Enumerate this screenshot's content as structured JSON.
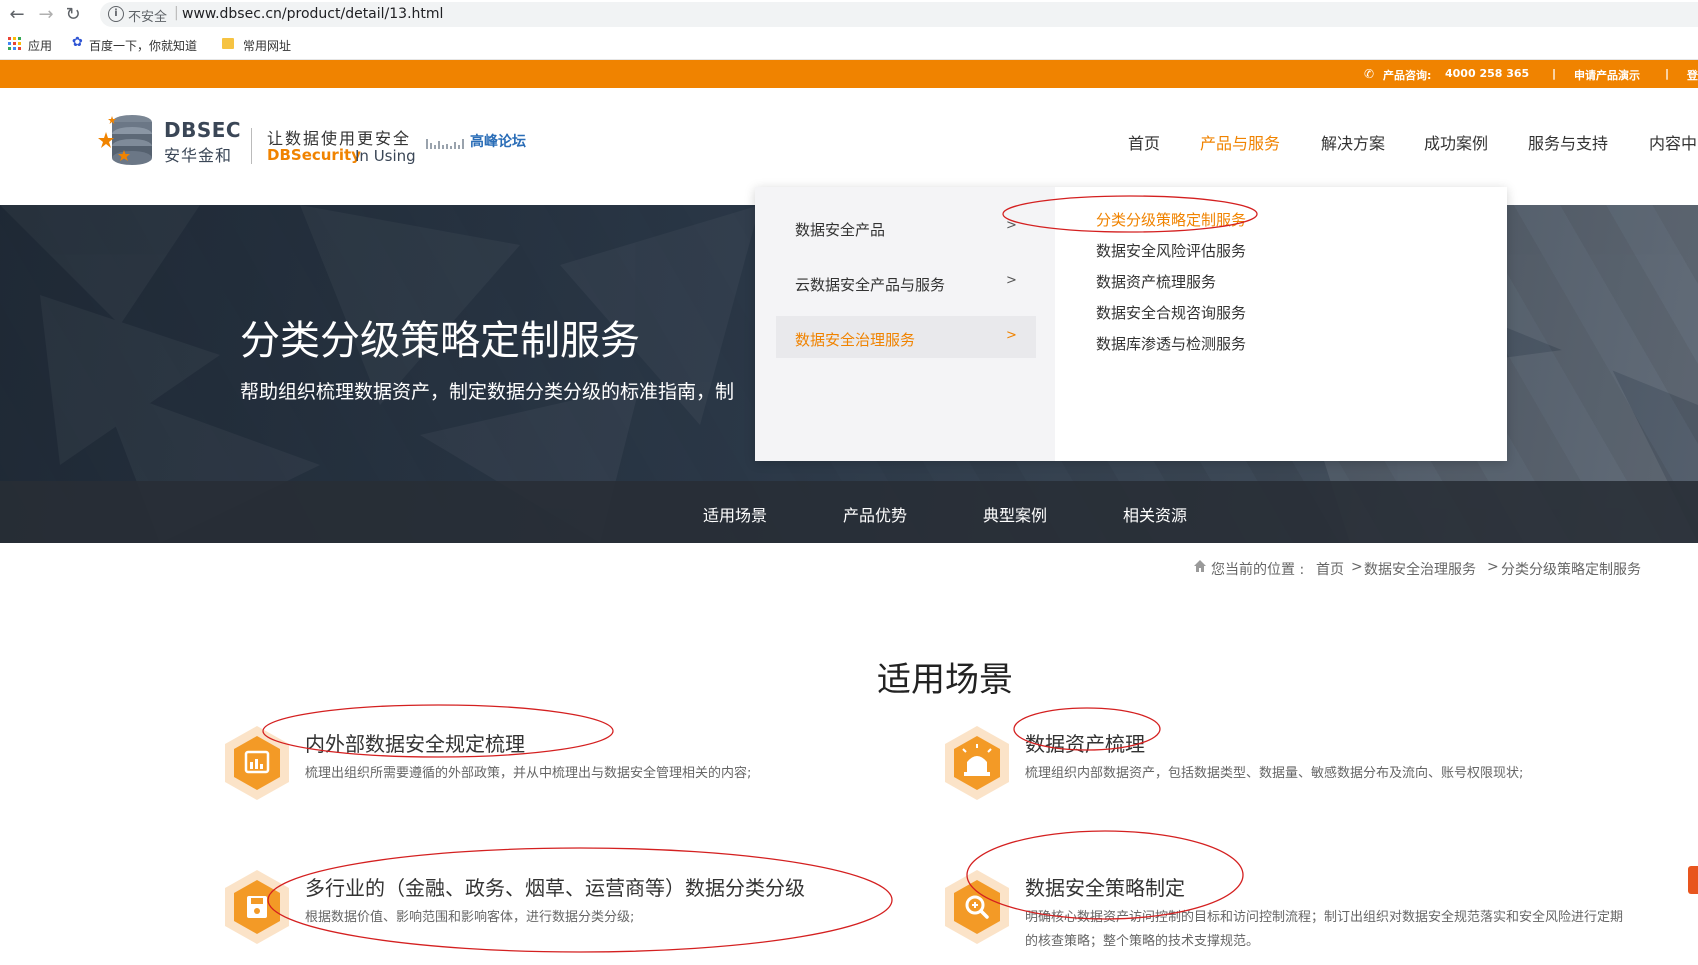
{
  "browser": {
    "security_label": "不安全",
    "url": "www.dbsec.cn/product/detail/13.html",
    "bookmarks": [
      {
        "label": "应用",
        "icon": "apps-icon"
      },
      {
        "label": "百度一下，你就知道",
        "icon": "baidu-paw-icon"
      },
      {
        "label": "常用网址",
        "icon": "folder-icon"
      }
    ]
  },
  "topbar": {
    "consult_label": "产品咨询:",
    "phone": "4000 258 365",
    "separator": "|",
    "demo_label": "申请产品演示",
    "separator2": "|",
    "trailing": "登",
    "color": "#f08300"
  },
  "logo": {
    "en": "DBSEC",
    "cn": "安华金和",
    "slogan_cn": "让数据使用更安全",
    "slogan_en_bold": "DBSecurity",
    "slogan_en_rest": "In Using",
    "forum": "高峰论坛"
  },
  "nav": {
    "items": [
      "首页",
      "产品与服务",
      "解决方案",
      "成功案例",
      "服务与支持",
      "内容中"
    ],
    "active_index": 1,
    "active_color": "#f08300"
  },
  "hero": {
    "title": "分类分级策略定制服务",
    "subtitle": "帮助组织梳理数据资产，制定数据分类分级的标准指南，制",
    "subnav": [
      "适用场景",
      "产品优势",
      "典型案例",
      "相关资源"
    ]
  },
  "dropdown": {
    "categories": [
      {
        "label": "数据安全产品",
        "arrow": ">"
      },
      {
        "label": "云数据安全产品与服务",
        "arrow": ">"
      },
      {
        "label": "数据安全治理服务",
        "arrow": ">"
      }
    ],
    "active_category": 2,
    "subitems": [
      "分类分级策略定制服务",
      "数据安全风险评估服务",
      "数据资产梳理服务",
      "数据安全合规咨询服务",
      "数据库渗透与检测服务"
    ],
    "active_subitem": 0
  },
  "breadcrumb": {
    "prefix": "您当前的位置 :",
    "items": [
      "首页",
      "数据安全治理服务",
      "分类分级策略定制服务"
    ],
    "sep": ">"
  },
  "scenarios": {
    "title": "适用场景",
    "items": [
      {
        "title": "内外部数据安全规定梳理",
        "desc": "梳理出组织所需要遵循的外部政策，并从中梳理出与数据安全管理相关的内容;",
        "icon": "calendar-chart-icon"
      },
      {
        "title": "数据资产梳理",
        "desc": "梳理组织内部数据资产，包括数据类型、数据量、敏感数据分布及流向、账号权限现状;",
        "icon": "alarm-light-icon"
      },
      {
        "title": "多行业的（金融、政务、烟草、运营商等）数据分类分级",
        "desc": "根据数据价值、影响范围和影响客体，进行数据分类分级;",
        "icon": "save-disk-icon"
      },
      {
        "title": "数据安全策略制定",
        "desc": "明确核心数据资产访问控制的目标和访问控制流程；制订出组织对数据安全规范落实和安全风险进行定期的核查策略；整个策略的技术支撑规范。",
        "icon": "magnifier-icon"
      }
    ]
  }
}
